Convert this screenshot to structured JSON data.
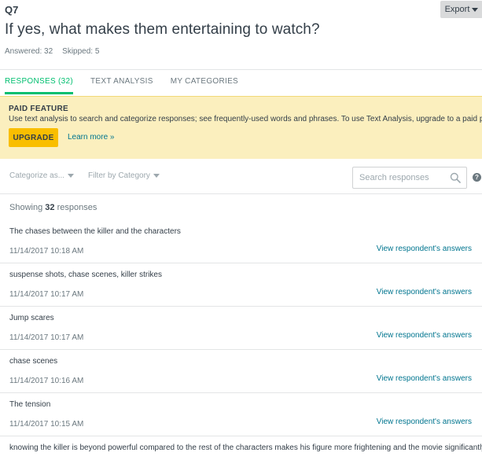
{
  "question": {
    "number": "Q7",
    "title": "If yes, what makes them entertaining to watch?",
    "answered": "Answered: 32",
    "skipped": "Skipped: 5"
  },
  "export_label": "Export",
  "tabs": [
    {
      "label": "RESPONSES (32)",
      "active": true
    },
    {
      "label": "TEXT ANALYSIS",
      "active": false
    },
    {
      "label": "MY CATEGORIES",
      "active": false
    }
  ],
  "paid_banner": {
    "title": "PAID FEATURE",
    "description": "Use text analysis to search and categorize responses; see frequently-used words and phrases. To use Text Analysis, upgrade to a paid plan .",
    "upgrade_label": "UPGRADE",
    "learn_more": "Learn more »"
  },
  "filters": {
    "categorize": "Categorize as...",
    "filter_category": "Filter by Category",
    "search_placeholder": "Search responses",
    "help": "?"
  },
  "showing": {
    "prefix": "Showing",
    "count": "32",
    "suffix": "responses"
  },
  "responses": [
    {
      "text": "The chases between the killer and the characters",
      "date": "11/14/2017 10:18 AM",
      "link": "View respondent's answers"
    },
    {
      "text": "suspense shots, chase scenes, killer strikes",
      "date": "11/14/2017 10:17 AM",
      "link": "View respondent's answers"
    },
    {
      "text": "Jump scares",
      "date": "11/14/2017 10:17 AM",
      "link": "View respondent's answers"
    },
    {
      "text": "chase scenes",
      "date": "11/14/2017 10:16 AM",
      "link": "View respondent's answers"
    },
    {
      "text": "The tension",
      "date": "11/14/2017 10:15 AM",
      "link": "View respondent's answers"
    },
    {
      "text": "knowing the killer is beyond powerful compared to the rest of the characters makes his figure more frightening and the movie significantly",
      "date": "",
      "link": ""
    }
  ],
  "colors": {
    "accent_green": "#00bf6f",
    "link_teal": "#00758f",
    "banner_bg": "#fbefbe",
    "upgrade_yellow": "#f9be00"
  }
}
